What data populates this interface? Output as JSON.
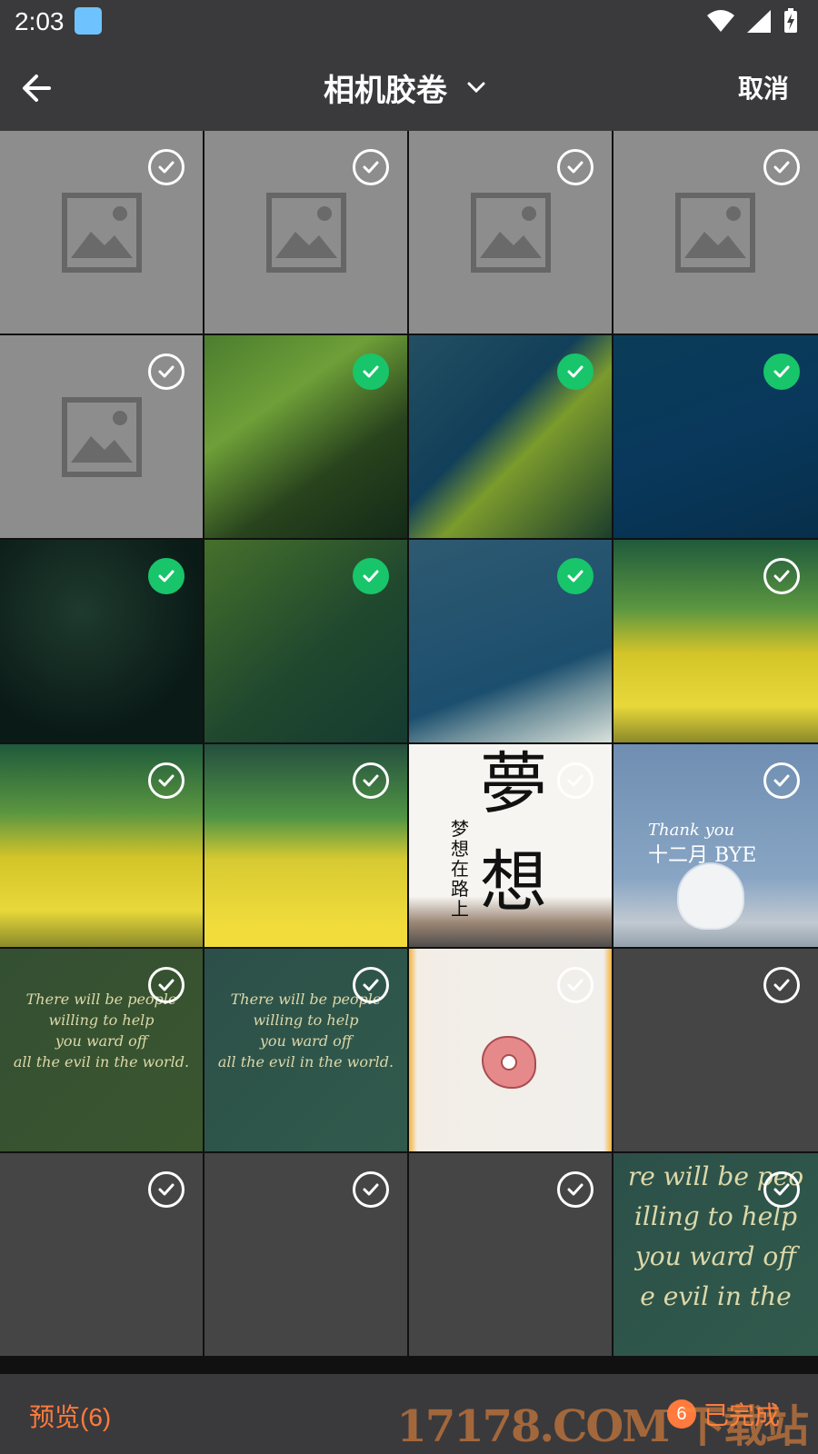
{
  "status_bar": {
    "time": "2:03",
    "app_icon": "app-icon",
    "wifi_icon": "wifi-icon",
    "signal_icon": "cell-signal-icon",
    "battery_icon": "battery-charging-icon"
  },
  "top_bar": {
    "title": "相机胶卷",
    "cancel_label": "取消"
  },
  "colors": {
    "status_and_bars": "#3a3a3c",
    "accent": "#ff7a3d",
    "selected": "#18c56a",
    "placeholder": "#8d8d8d"
  },
  "grid": {
    "columns": 4,
    "items": [
      {
        "kind": "placeholder",
        "selected": false,
        "icon": "image-placeholder-icon"
      },
      {
        "kind": "placeholder",
        "selected": false,
        "icon": "image-placeholder-icon"
      },
      {
        "kind": "placeholder",
        "selected": false,
        "icon": "image-placeholder-icon"
      },
      {
        "kind": "placeholder",
        "selected": false,
        "icon": "image-placeholder-icon"
      },
      {
        "kind": "placeholder",
        "selected": false,
        "icon": "image-placeholder-icon"
      },
      {
        "kind": "tree-green",
        "selected": true
      },
      {
        "kind": "tree-sky",
        "selected": true
      },
      {
        "kind": "night-sky",
        "selected": true
      },
      {
        "kind": "dark-forest",
        "selected": true
      },
      {
        "kind": "tree-dark",
        "selected": true
      },
      {
        "kind": "tree-cloud",
        "selected": true
      },
      {
        "kind": "yellow-field",
        "selected": false
      },
      {
        "kind": "yellow-field",
        "selected": false
      },
      {
        "kind": "yellow-field-person",
        "selected": false
      },
      {
        "kind": "dream-poster",
        "selected": false,
        "text_main": "夢想",
        "text_side": "梦想在路上"
      },
      {
        "kind": "winter-card",
        "selected": false,
        "text_thanks": "Thank you",
        "text_bye": "十二月 BYE"
      },
      {
        "kind": "green-quote",
        "selected": false,
        "text": [
          "There will be people",
          "willing to help",
          "you ward off",
          "all the evil in the world."
        ]
      },
      {
        "kind": "teal-quote",
        "selected": false,
        "text": [
          "There will be people",
          "willing to help",
          "you ward off",
          "all the evil in the world."
        ]
      },
      {
        "kind": "flower-card",
        "selected": false
      },
      {
        "kind": "blank",
        "selected": false
      },
      {
        "kind": "blank",
        "selected": false
      },
      {
        "kind": "blank",
        "selected": false
      },
      {
        "kind": "blank",
        "selected": false
      },
      {
        "kind": "large-quote",
        "selected": false,
        "text": [
          "re will be peo",
          "illing to help",
          "you ward off",
          "e evil in the"
        ]
      }
    ]
  },
  "bottom_bar": {
    "preview_label": "预览(6)",
    "done_count": "6",
    "done_label": "已完成"
  },
  "watermark": "17178.COM 下载站"
}
